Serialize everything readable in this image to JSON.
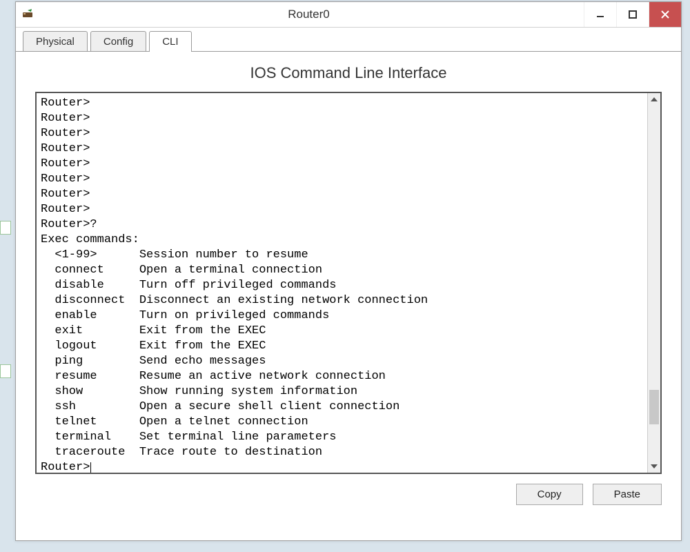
{
  "window": {
    "title": "Router0"
  },
  "tabs": {
    "physical": "Physical",
    "config": "Config",
    "cli": "CLI"
  },
  "panel": {
    "title": "IOS Command Line Interface"
  },
  "terminal": {
    "prompt_lines": [
      "Router>",
      "Router>",
      "Router>",
      "Router>",
      "Router>",
      "Router>",
      "Router>",
      "Router>",
      "Router>?"
    ],
    "header": "Exec commands:",
    "commands": [
      {
        "cmd": "<1-99>",
        "desc": "Session number to resume"
      },
      {
        "cmd": "connect",
        "desc": "Open a terminal connection"
      },
      {
        "cmd": "disable",
        "desc": "Turn off privileged commands"
      },
      {
        "cmd": "disconnect",
        "desc": "Disconnect an existing network connection"
      },
      {
        "cmd": "enable",
        "desc": "Turn on privileged commands"
      },
      {
        "cmd": "exit",
        "desc": "Exit from the EXEC"
      },
      {
        "cmd": "logout",
        "desc": "Exit from the EXEC"
      },
      {
        "cmd": "ping",
        "desc": "Send echo messages"
      },
      {
        "cmd": "resume",
        "desc": "Resume an active network connection"
      },
      {
        "cmd": "show",
        "desc": "Show running system information"
      },
      {
        "cmd": "ssh",
        "desc": "Open a secure shell client connection"
      },
      {
        "cmd": "telnet",
        "desc": "Open a telnet connection"
      },
      {
        "cmd": "terminal",
        "desc": "Set terminal line parameters"
      },
      {
        "cmd": "traceroute",
        "desc": "Trace route to destination"
      }
    ],
    "final_prompt": "Router>"
  },
  "buttons": {
    "copy": "Copy",
    "paste": "Paste"
  }
}
